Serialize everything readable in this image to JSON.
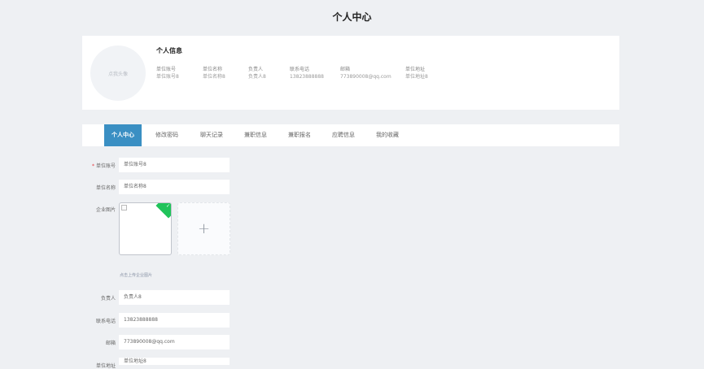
{
  "page": {
    "title": "个人中心"
  },
  "profile": {
    "avatar_placeholder": "点我头像",
    "section_title": "个人信息",
    "fields": [
      {
        "label": "单位账号",
        "value": "单位账号8"
      },
      {
        "label": "单位名称",
        "value": "单位名称8"
      },
      {
        "label": "负责人",
        "value": "负责人8"
      },
      {
        "label": "联系电话",
        "value": "13823888888"
      },
      {
        "label": "邮箱",
        "value": "773890008@qq.com"
      },
      {
        "label": "单位地址",
        "value": "单位地址8"
      }
    ]
  },
  "tabs": [
    {
      "label": "个人中心",
      "active": true
    },
    {
      "label": "修改密码"
    },
    {
      "label": "聊天记录"
    },
    {
      "label": "兼职信息"
    },
    {
      "label": "兼职报名"
    },
    {
      "label": "应聘信息"
    },
    {
      "label": "我的收藏"
    }
  ],
  "form": {
    "account": {
      "label": "单位账号",
      "value": "单位账号8",
      "required_mark": "*"
    },
    "name": {
      "label": "单位名称",
      "value": "单位名称8"
    },
    "image": {
      "label": "企业图片",
      "add_symbol": "+",
      "tip": "点击上传企业图片",
      "check_symbol": "✓"
    },
    "contact": {
      "label": "负责人",
      "value": "负责人8"
    },
    "phone": {
      "label": "联系电话",
      "value": "13823888888"
    },
    "email": {
      "label": "邮箱",
      "value": "773890008@qq.com"
    },
    "address": {
      "label": "单位地址",
      "value": "单位地址8"
    }
  },
  "colors": {
    "accent": "#3a8fc3",
    "success": "#20c35a",
    "background": "#eef0f3"
  }
}
